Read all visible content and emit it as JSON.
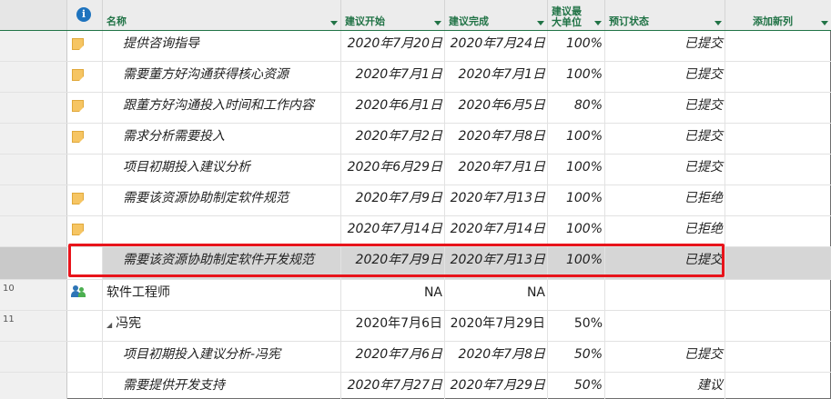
{
  "header": {
    "info_icon": "info-icon",
    "info_symbol": "i",
    "col_name": "名称",
    "col_start": "建议开始",
    "col_end": "建议完成",
    "col_max_units_l1": "建议最",
    "col_max_units_l2": "大单位",
    "col_status": "预订状态",
    "col_add": "添加新列"
  },
  "rows": [
    {
      "id": "",
      "icon": "note-icon",
      "name": "提供咨询指导",
      "start": "2020年7月20日",
      "end": "2020年7月24日",
      "pct": "100%",
      "status": "已提交"
    },
    {
      "id": "",
      "icon": "note-icon",
      "name": "需要董方好沟通获得核心资源",
      "start": "2020年7月1日",
      "end": "2020年7月1日",
      "pct": "100%",
      "status": "已提交"
    },
    {
      "id": "",
      "icon": "note-icon",
      "name": "跟董方好沟通投入时间和工作内容",
      "start": "2020年6月1日",
      "end": "2020年6月5日",
      "pct": "80%",
      "status": "已提交"
    },
    {
      "id": "",
      "icon": "note-icon",
      "name": "需求分析需要投入",
      "start": "2020年7月2日",
      "end": "2020年7月8日",
      "pct": "100%",
      "status": "已提交"
    },
    {
      "id": "",
      "icon": "",
      "name": "项目初期投入建议分析",
      "start": "2020年6月29日",
      "end": "2020年7月1日",
      "pct": "100%",
      "status": "已提交"
    },
    {
      "id": "",
      "icon": "note-icon",
      "name": "需要该资源协助制定软件规范",
      "start": "2020年7月9日",
      "end": "2020年7月13日",
      "pct": "100%",
      "status": "已拒绝"
    },
    {
      "id": "",
      "icon": "note-icon",
      "name": "",
      "start": "2020年7月14日",
      "end": "2020年7月14日",
      "pct": "100%",
      "status": "已拒绝"
    },
    {
      "id": "",
      "icon": "",
      "name": "需要该资源协助制定软件开发规范",
      "start": "2020年7月9日",
      "end": "2020年7月13日",
      "pct": "100%",
      "status": "已提交"
    },
    {
      "id": "10",
      "icon": "people-icon",
      "name": "软件工程师",
      "start": "NA",
      "end": "NA",
      "pct": "",
      "status": ""
    },
    {
      "id": "11",
      "icon": "",
      "name": "冯宪",
      "start": "2020年7月6日",
      "end": "2020年7月29日",
      "pct": "50%",
      "status": ""
    },
    {
      "id": "",
      "icon": "",
      "name": "项目初期投入建议分析-冯宪",
      "start": "2020年7月6日",
      "end": "2020年7月8日",
      "pct": "50%",
      "status": "已提交"
    },
    {
      "id": "",
      "icon": "",
      "name": "需要提供开发支持",
      "start": "2020年7月27日",
      "end": "2020年7月29日",
      "pct": "50%",
      "status": "建议"
    }
  ],
  "colors": {
    "accent": "#217346",
    "highlight": "#e8141b",
    "selected_row": "#d6d6d6"
  }
}
